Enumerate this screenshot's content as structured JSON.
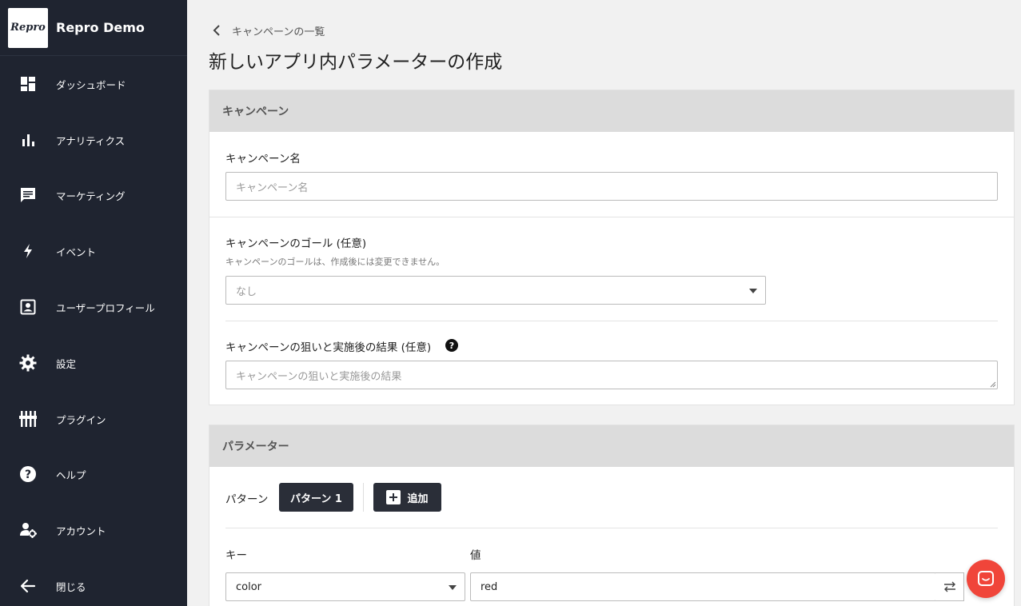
{
  "brand": {
    "logo_text": "Repro",
    "name": "Repro Demo"
  },
  "sidebar": {
    "items": [
      {
        "label": "ダッシュボード",
        "icon": "dashboard-icon"
      },
      {
        "label": "アナリティクス",
        "icon": "bar-chart-icon"
      },
      {
        "label": "マーケティング",
        "icon": "message-icon"
      },
      {
        "label": "イベント",
        "icon": "bolt-icon"
      },
      {
        "label": "ユーザープロフィール",
        "icon": "user-card-icon"
      },
      {
        "label": "設定",
        "icon": "gear-icon"
      },
      {
        "label": "プラグイン",
        "icon": "plugin-icon"
      },
      {
        "label": "ヘルプ",
        "icon": "help-icon"
      },
      {
        "label": "アカウント",
        "icon": "account-settings-icon"
      },
      {
        "label": "閉じる",
        "icon": "arrow-left-icon"
      }
    ]
  },
  "breadcrumb": {
    "label": "キャンペーンの一覧"
  },
  "page": {
    "title": "新しいアプリ内パラメーターの作成"
  },
  "campaign_section": {
    "header": "キャンペーン",
    "name_label": "キャンペーン名",
    "name_placeholder": "キャンペーン名",
    "goal_label": "キャンペーンのゴール (任意)",
    "goal_help": "キャンペーンのゴールは、作成後には変更できません。",
    "goal_value": "なし",
    "aim_label": "キャンペーンの狙いと実施後の結果 (任意)",
    "aim_help_icon": "?",
    "aim_placeholder": "キャンペーンの狙いと実施後の結果"
  },
  "parameter_section": {
    "header": "パラメーター",
    "pattern_label": "パターン",
    "pattern_button": "パターン 1",
    "add_button": "追加",
    "key_label": "キー",
    "value_label": "値",
    "key_value": "color",
    "value_value": "red"
  },
  "colors": {
    "sidebar_bg": "#1f2430",
    "chat_bubble": "#f0453a",
    "dark_button": "#2a2e38"
  }
}
